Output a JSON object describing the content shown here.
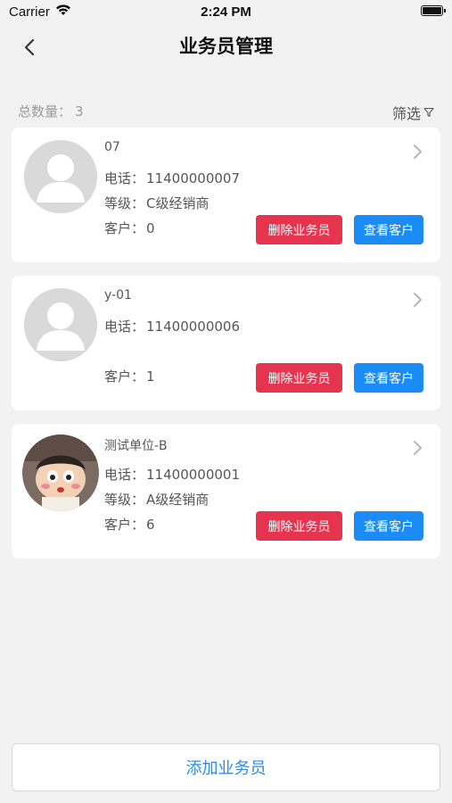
{
  "status_bar": {
    "carrier": "Carrier",
    "time": "2:24 PM"
  },
  "nav": {
    "title": "业务员管理"
  },
  "summary": {
    "total_label": "总数量：",
    "total_value": "3",
    "filter_label": "筛选"
  },
  "cards": [
    {
      "name": "07",
      "phone_label": "电话：",
      "phone": "11400000007",
      "level_label": "等级：",
      "level": "C级经销商",
      "customer_label": "客户：",
      "customers": "0",
      "avatar": "default-avatar"
    },
    {
      "name": "y-01",
      "phone_label": "电话：",
      "phone": "11400000006",
      "level_label": "",
      "level": "",
      "customer_label": "客户：",
      "customers": "1",
      "avatar": "default-avatar"
    },
    {
      "name": "测试单位-B",
      "phone_label": "电话：",
      "phone": "11400000001",
      "level_label": "等级：",
      "level": "A级经销商",
      "customer_label": "客户：",
      "customers": "6",
      "avatar": "photo-avatar"
    }
  ],
  "buttons": {
    "delete": "删除业务员",
    "view": "查看客户",
    "add": "添加业务员"
  },
  "colors": {
    "delete": "#e6344f",
    "view": "#1b8cf5",
    "add_text": "#2a8ce8"
  }
}
